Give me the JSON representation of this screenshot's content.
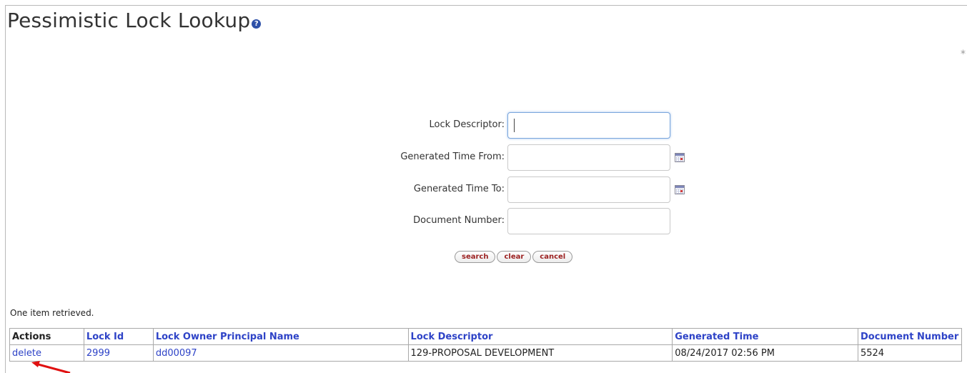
{
  "page": {
    "title": "Pessimistic Lock Lookup",
    "help_icon": "?",
    "required_marker": "*"
  },
  "form": {
    "fields": [
      {
        "label": "Lock Descriptor:",
        "value": "",
        "placeholder": ""
      },
      {
        "label": "Generated Time From:",
        "value": "",
        "placeholder": "",
        "icon": "calendar-icon"
      },
      {
        "label": "Generated Time To:",
        "value": "",
        "placeholder": "",
        "icon": "calendar-icon"
      },
      {
        "label": "Document Number:",
        "value": "",
        "placeholder": ""
      }
    ],
    "buttons": {
      "search": "search",
      "clear": "clear",
      "cancel": "cancel"
    }
  },
  "results": {
    "summary": "One item retrieved.",
    "columns": [
      "Actions",
      "Lock Id",
      "Lock Owner Principal Name",
      "Lock Descriptor",
      "Generated Time",
      "Document Number"
    ],
    "rows": [
      {
        "action": "delete",
        "lock_id": "2999",
        "owner": "dd00097",
        "descriptor": "129-PROPOSAL DEVELOPMENT",
        "generated_time": "08/24/2017 02:56 PM",
        "document_number": "5524"
      }
    ]
  },
  "colors": {
    "link": "#2e43c7",
    "button_text": "#9b1f1f",
    "annotation_arrow": "#e01010"
  }
}
